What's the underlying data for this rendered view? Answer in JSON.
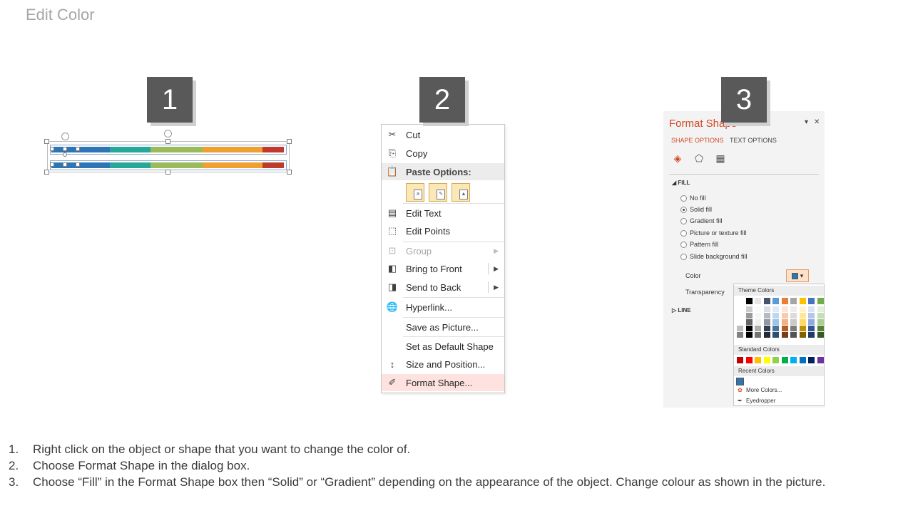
{
  "slide": {
    "title": "Edit Color"
  },
  "steps": [
    "1",
    "2",
    "3"
  ],
  "context_menu": {
    "items": [
      {
        "label": "Cut",
        "icon": "scissors-icon"
      },
      {
        "label": "Copy",
        "icon": "copy-icon"
      },
      {
        "label": "Paste Options:",
        "icon": "paste-icon"
      },
      {
        "label": "Edit Text",
        "icon": "edit-text-icon"
      },
      {
        "label": "Edit Points",
        "icon": "edit-points-icon"
      },
      {
        "label": "Group",
        "icon": "group-icon"
      },
      {
        "label": "Bring to Front",
        "icon": "bring-front-icon"
      },
      {
        "label": "Send to Back",
        "icon": "send-back-icon"
      },
      {
        "label": "Hyperlink...",
        "icon": "hyperlink-icon"
      },
      {
        "label": "Save as Picture...",
        "icon": ""
      },
      {
        "label": "Set as Default Shape",
        "icon": ""
      },
      {
        "label": "Size and Position...",
        "icon": "size-position-icon"
      },
      {
        "label": "Format Shape...",
        "icon": "format-shape-icon"
      }
    ]
  },
  "format_pane": {
    "title": "Format Shape",
    "tabs": [
      "SHAPE OPTIONS",
      "TEXT OPTIONS"
    ],
    "fill_section": "FILL",
    "fill_options": [
      {
        "label": "No fill",
        "selected": false
      },
      {
        "label": "Solid fill",
        "selected": true
      },
      {
        "label": "Gradient fill",
        "selected": false
      },
      {
        "label": "Picture or texture fill",
        "selected": false
      },
      {
        "label": "Pattern fill",
        "selected": false
      },
      {
        "label": "Slide background fill",
        "selected": false
      }
    ],
    "color_label": "Color",
    "transparency_label": "Transparency",
    "line_section": "LINE"
  },
  "color_popup": {
    "theme_header": "Theme Colors",
    "standard_header": "Standard Colors",
    "recent_header": "Recent Colors",
    "more_colors": "More Colors...",
    "eyedropper": "Eyedropper",
    "theme_base": [
      "#ffffff",
      "#000000",
      "#e7e6e6",
      "#44546a",
      "#5b9bd5",
      "#ed7d31",
      "#a5a5a5",
      "#ffc000",
      "#4472c4",
      "#70ad47"
    ],
    "standard": [
      "#c00000",
      "#ff0000",
      "#ffc000",
      "#ffff00",
      "#92d050",
      "#00b050",
      "#00b0f0",
      "#0070c0",
      "#002060",
      "#7030a0"
    ],
    "recent": [
      "#2e75b6"
    ]
  },
  "instructions": [
    {
      "num": "1.",
      "text": "Right click on the object or shape that you want to change the color of."
    },
    {
      "num": "2.",
      "text": "Choose Format Shape in the dialog box."
    },
    {
      "num": "3.",
      "text": "Choose “Fill” in the Format Shape box then “Solid” or “Gradient” depending on the appearance of the object. Change colour as shown in the picture."
    }
  ]
}
